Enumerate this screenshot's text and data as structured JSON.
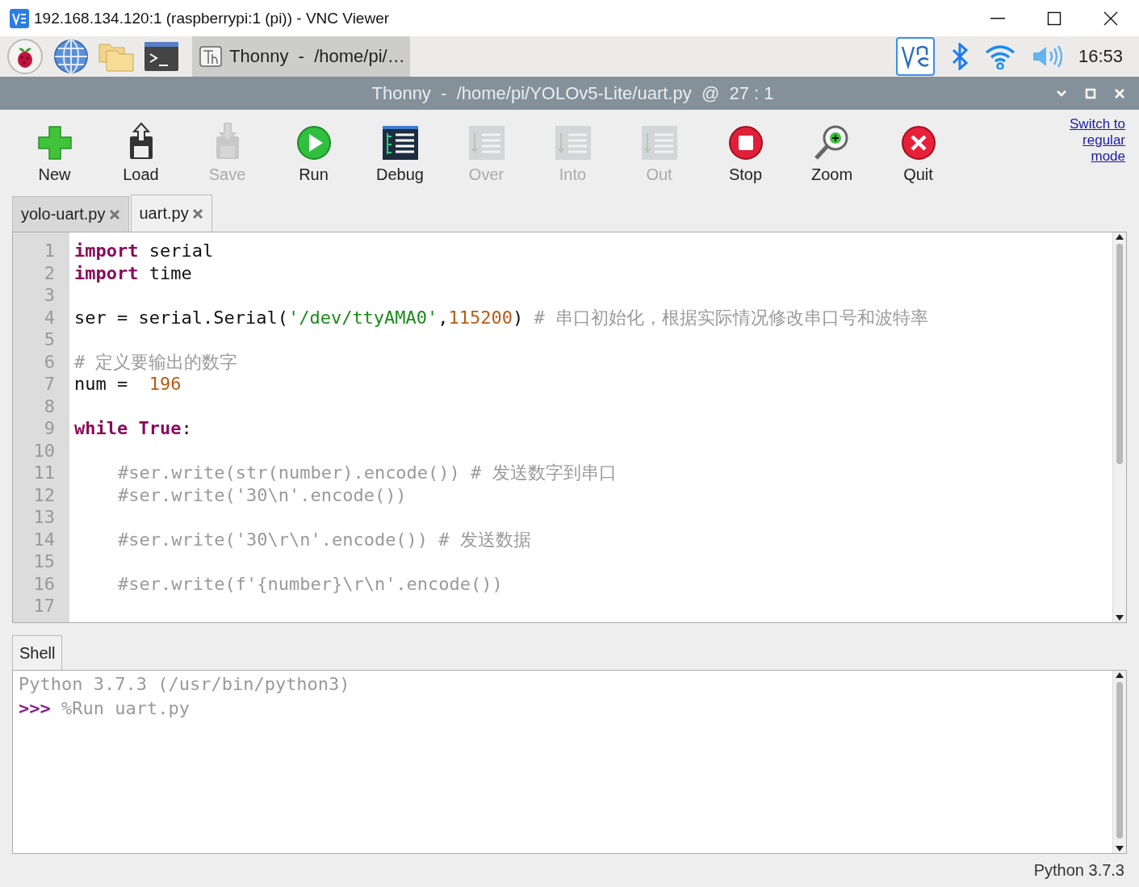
{
  "vnc_window": {
    "title": "192.168.134.120:1 (raspberrypi:1 (pi)) - VNC Viewer"
  },
  "taskbar": {
    "task_button": {
      "label": "Thonny  -  /home/pi/…"
    },
    "clock": "16:53"
  },
  "thonny_window": {
    "title": "Thonny  -  /home/pi/YOLOv5-Lite/uart.py  @  27 : 1"
  },
  "toolbar": [
    {
      "kind": "new",
      "label": "New",
      "disabled": false
    },
    {
      "kind": "load",
      "label": "Load",
      "disabled": false
    },
    {
      "kind": "save",
      "label": "Save",
      "disabled": true
    },
    {
      "kind": "run",
      "label": "Run",
      "disabled": false
    },
    {
      "kind": "debug",
      "label": "Debug",
      "disabled": false
    },
    {
      "kind": "over",
      "label": "Over",
      "disabled": true
    },
    {
      "kind": "into",
      "label": "Into",
      "disabled": true
    },
    {
      "kind": "out",
      "label": "Out",
      "disabled": true
    },
    {
      "kind": "stop",
      "label": "Stop",
      "disabled": false
    },
    {
      "kind": "zoom",
      "label": "Zoom",
      "disabled": false
    },
    {
      "kind": "quit",
      "label": "Quit",
      "disabled": false
    }
  ],
  "mode_link": "Switch to regular mode",
  "editor_tabs": [
    {
      "label": "yolo-uart.py",
      "selected": false
    },
    {
      "label": "uart.py",
      "selected": true
    }
  ],
  "editor": {
    "lines": [
      {
        "number": "1",
        "indented": false,
        "tokens": [
          {
            "kind": "keyword",
            "text": "import"
          },
          {
            "kind": "plain",
            "text": " serial"
          }
        ]
      },
      {
        "number": "2",
        "indented": false,
        "tokens": [
          {
            "kind": "keyword",
            "text": "import"
          },
          {
            "kind": "plain",
            "text": " time"
          }
        ]
      },
      {
        "number": "3"
      },
      {
        "number": "4",
        "indented": false,
        "tokens": [
          {
            "kind": "plain",
            "text": "ser = serial.Serial("
          },
          {
            "kind": "string",
            "text": "'/dev/ttyAMA0'"
          },
          {
            "kind": "plain",
            "text": ","
          },
          {
            "kind": "number",
            "text": "115200"
          },
          {
            "kind": "plain",
            "text": ")"
          },
          {
            "kind": "comment",
            "text": " # 串口初始化，根据实际情况修改串口号和波特率"
          }
        ]
      },
      {
        "number": "5"
      },
      {
        "number": "6",
        "indented": false,
        "tokens": [
          {
            "kind": "comment",
            "text": "# 定义要输出的数字"
          }
        ]
      },
      {
        "number": "7",
        "indented": false,
        "tokens": [
          {
            "kind": "plain",
            "text": "num =  "
          },
          {
            "kind": "number",
            "text": "196"
          }
        ]
      },
      {
        "number": "8"
      },
      {
        "number": "9",
        "indented": false,
        "tokens": [
          {
            "kind": "keyword",
            "text": "while"
          },
          {
            "kind": "keyword",
            "text": " True"
          },
          {
            "kind": "plain",
            "text": ":"
          }
        ]
      },
      {
        "number": "10"
      },
      {
        "number": "11",
        "indented": true,
        "tokens": [
          {
            "kind": "comment",
            "text": "#ser.write(str(number).encode()) # 发送数字到串口"
          }
        ]
      },
      {
        "number": "12",
        "indented": true,
        "tokens": [
          {
            "kind": "comment",
            "text": "#ser.write('30\\n'.encode())"
          }
        ]
      },
      {
        "number": "13"
      },
      {
        "number": "14",
        "indented": true,
        "tokens": [
          {
            "kind": "comment",
            "text": "#ser.write('30\\r\\n'.encode()) # 发送数据"
          }
        ]
      },
      {
        "number": "15"
      },
      {
        "number": "16",
        "indented": true,
        "tokens": [
          {
            "kind": "comment",
            "text": "#ser.write(f'{number}\\r\\n'.encode())"
          }
        ]
      },
      {
        "number": "17"
      }
    ]
  },
  "shell": {
    "tab": "Shell",
    "lines": [
      {
        "tokens": [
          {
            "kind": "output",
            "text": "Python 3.7.3 (/usr/bin/python3)"
          }
        ]
      },
      {
        "tokens": [
          {
            "kind": "prompt",
            "text": ">>>"
          },
          {
            "kind": "output",
            "text": " %Run uart.py"
          }
        ]
      }
    ]
  },
  "status_bar": "Python 3.7.3"
}
